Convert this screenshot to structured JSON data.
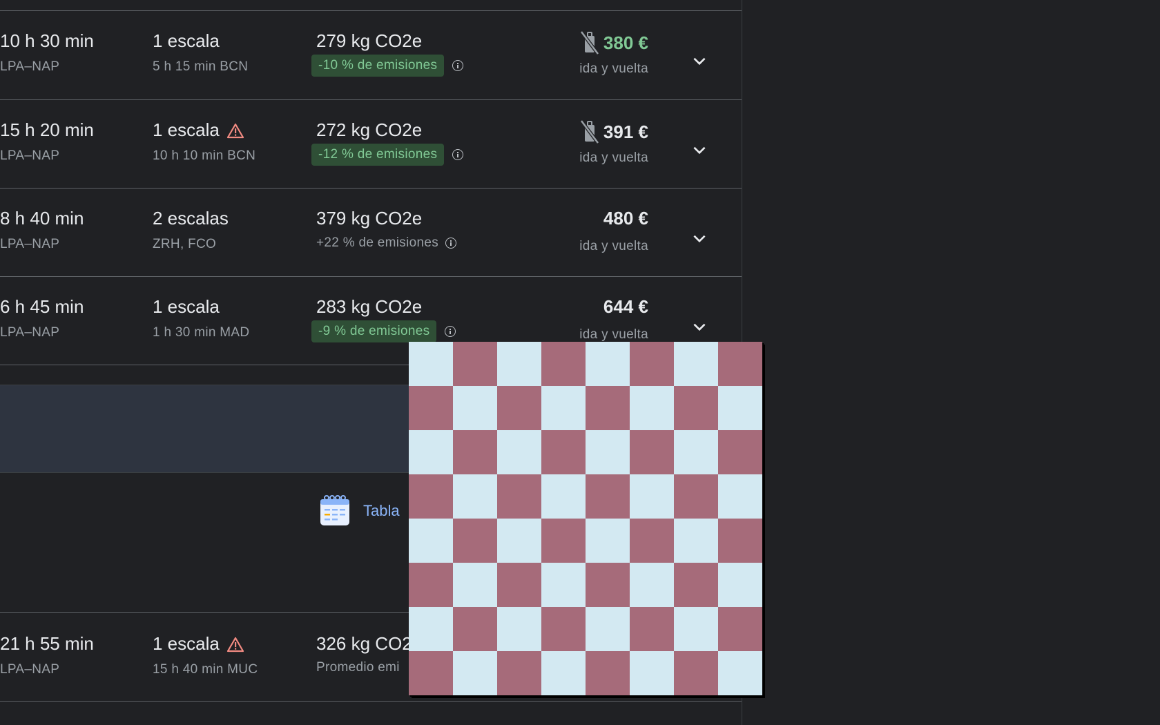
{
  "colors": {
    "background": "#202124",
    "badge_bg": "#2f4f36",
    "badge_text": "#81c995",
    "price_green": "#81c995",
    "link_blue": "#8ab4f8",
    "warning": "#f28b82",
    "checker_dark": "#a66b7a",
    "checker_light": "#d3e9f2"
  },
  "flights": [
    {
      "duration": "10 h 30 min",
      "route": "LPA–NAP",
      "stops": "1 escala",
      "stops_detail": "5 h 15 min BCN",
      "co2": "279 kg CO2e",
      "emissions": "-10 % de emisiones",
      "emissions_style": "badge",
      "price": "380 €",
      "price_highlight": true,
      "no_carry_on_icon": true,
      "warning_icon": false,
      "trip_type": "ida y vuelta"
    },
    {
      "duration": "15 h 20 min",
      "route": "LPA–NAP",
      "stops": "1 escala",
      "stops_detail": "10 h 10 min BCN",
      "co2": "272 kg CO2e",
      "emissions": "-12 % de emisiones",
      "emissions_style": "badge",
      "price": "391 €",
      "price_highlight": false,
      "no_carry_on_icon": true,
      "warning_icon": true,
      "trip_type": "ida y vuelta"
    },
    {
      "duration": "8 h 40 min",
      "route": "LPA–NAP",
      "stops": "2 escalas",
      "stops_detail": "ZRH, FCO",
      "co2": "379 kg CO2e",
      "emissions": "+22 % de emisiones",
      "emissions_style": "plain",
      "price": "480 €",
      "price_highlight": false,
      "no_carry_on_icon": false,
      "warning_icon": false,
      "trip_type": "ida y vuelta"
    },
    {
      "duration": "6 h 45 min",
      "route": "LPA–NAP",
      "stops": "1 escala",
      "stops_detail": "1 h 30 min MAD",
      "co2": "283 kg CO2e",
      "emissions": "-9 % de emisiones",
      "emissions_style": "badge",
      "price": "644 €",
      "price_highlight": false,
      "no_carry_on_icon": false,
      "warning_icon": false,
      "trip_type": "ida y vuelta"
    }
  ],
  "promo": {
    "tabla_label": "Tabla"
  },
  "last_flight": {
    "duration": "21 h 55 min",
    "route": "LPA–NAP",
    "stops": "1 escala",
    "stops_detail": "15 h 40 min MUC",
    "co2": "326 kg CO2",
    "emissions": "Promedio emi",
    "warning_icon": true
  },
  "icons": {
    "chevron": "chevron-down-icon",
    "info": "info-icon",
    "no_bag": "no-carry-on-bag-icon",
    "warning": "warning-icon",
    "calendar": "calendar-table-icon"
  }
}
